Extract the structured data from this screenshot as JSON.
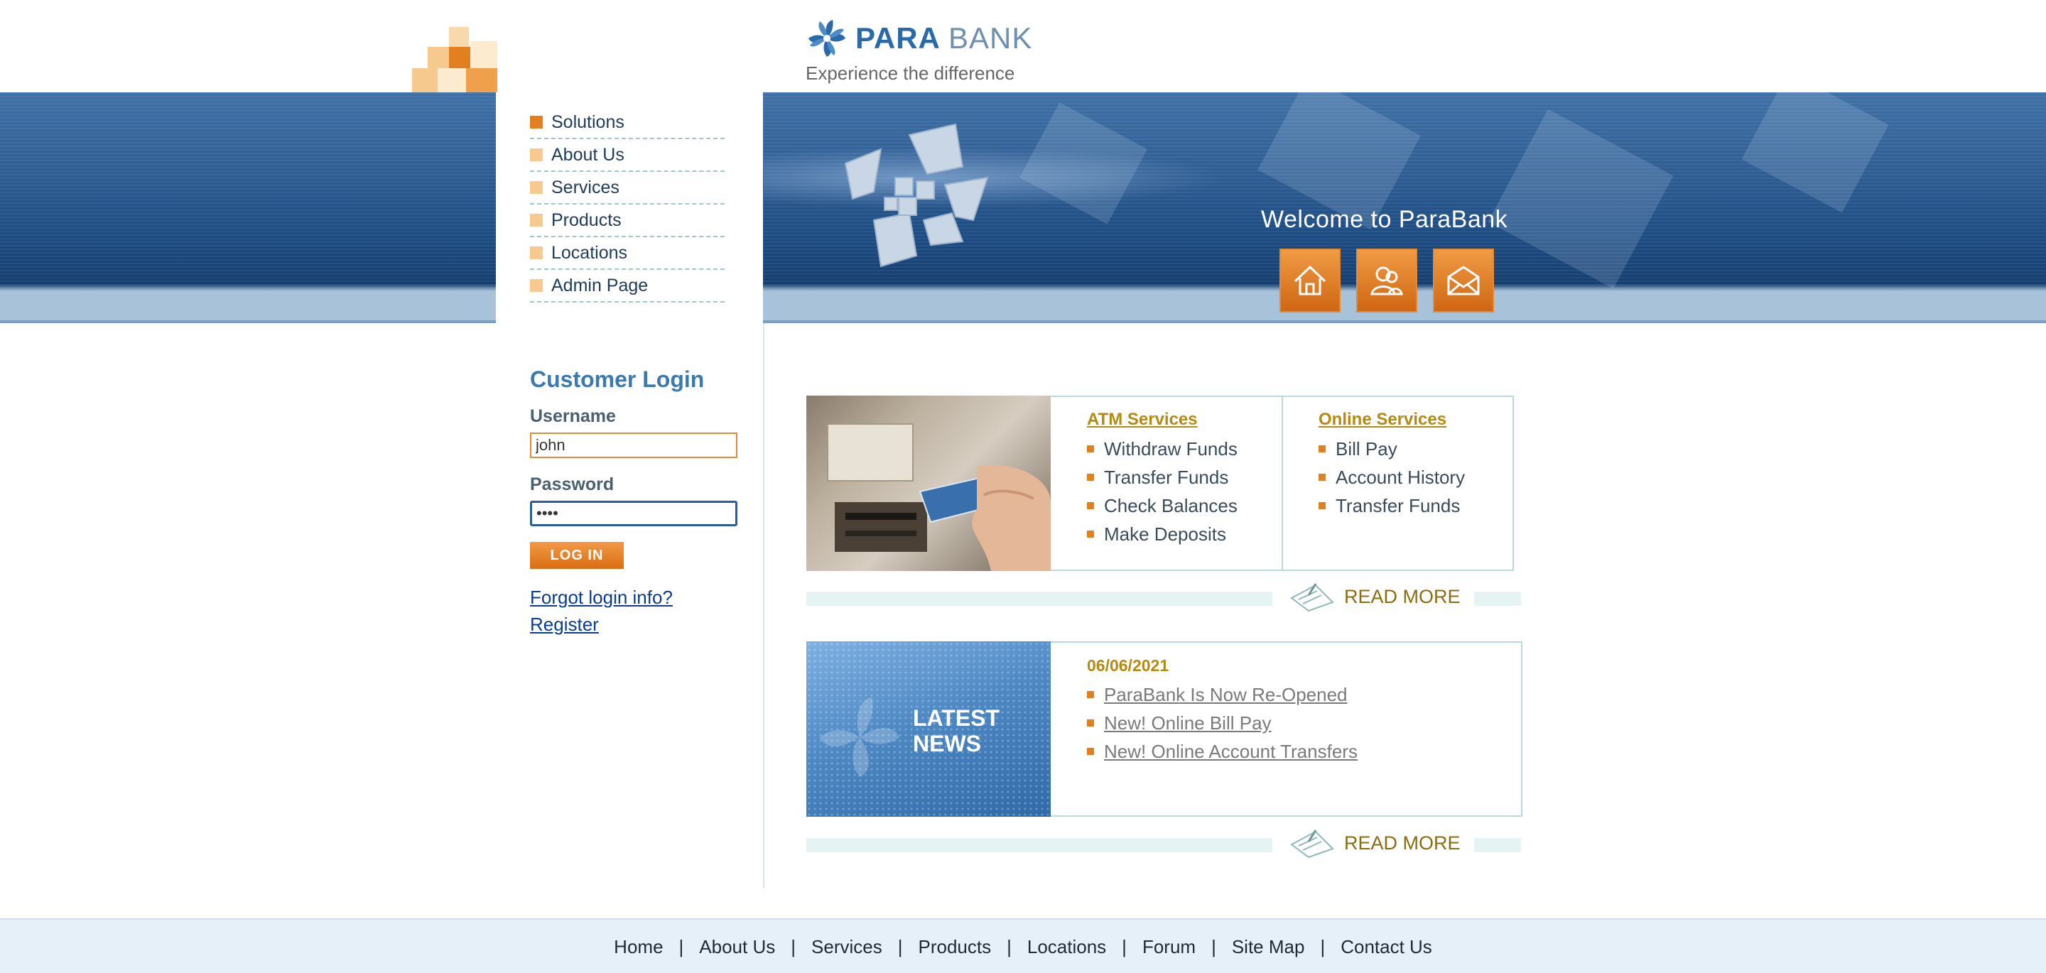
{
  "header": {
    "brand_para": "PARA",
    "brand_bank": "BANK",
    "tagline": "Experience the difference"
  },
  "menu": {
    "items": [
      {
        "label": "Solutions",
        "active": true
      },
      {
        "label": "About Us"
      },
      {
        "label": "Services"
      },
      {
        "label": "Products"
      },
      {
        "label": "Locations"
      },
      {
        "label": "Admin Page"
      }
    ]
  },
  "hero": {
    "welcome": "Welcome to ParaBank",
    "buttons": [
      "home-icon",
      "contacts-icon",
      "email-icon"
    ]
  },
  "login": {
    "title": "Customer Login",
    "username_label": "Username",
    "username_value": "john",
    "password_label": "Password",
    "password_value": "••••",
    "button_label": "LOG IN",
    "forgot_link": "Forgot login info?",
    "register_link": "Register"
  },
  "atm_services": {
    "heading": "ATM Services",
    "items": [
      "Withdraw Funds",
      "Transfer Funds",
      "Check Balances",
      "Make Deposits"
    ]
  },
  "online_services": {
    "heading": "Online Services",
    "items": [
      "Bill Pay",
      "Account History",
      "Transfer Funds"
    ]
  },
  "readmore": "READ MORE",
  "news": {
    "image_text_line1": "LATEST",
    "image_text_line2": "NEWS",
    "date": "06/06/2021",
    "items": [
      "ParaBank Is Now Re-Opened",
      "New! Online Bill Pay",
      "New! Online Account Transfers"
    ]
  },
  "footer": {
    "links": [
      "Home",
      "About Us",
      "Services",
      "Products",
      "Locations",
      "Forum",
      "Site Map",
      "Contact Us"
    ],
    "separator": "|"
  },
  "colors": {
    "accent_orange": "#e2801f",
    "brand_blue": "#2a6aa8",
    "link_blue": "#0a3d91",
    "gold": "#b58a12"
  }
}
